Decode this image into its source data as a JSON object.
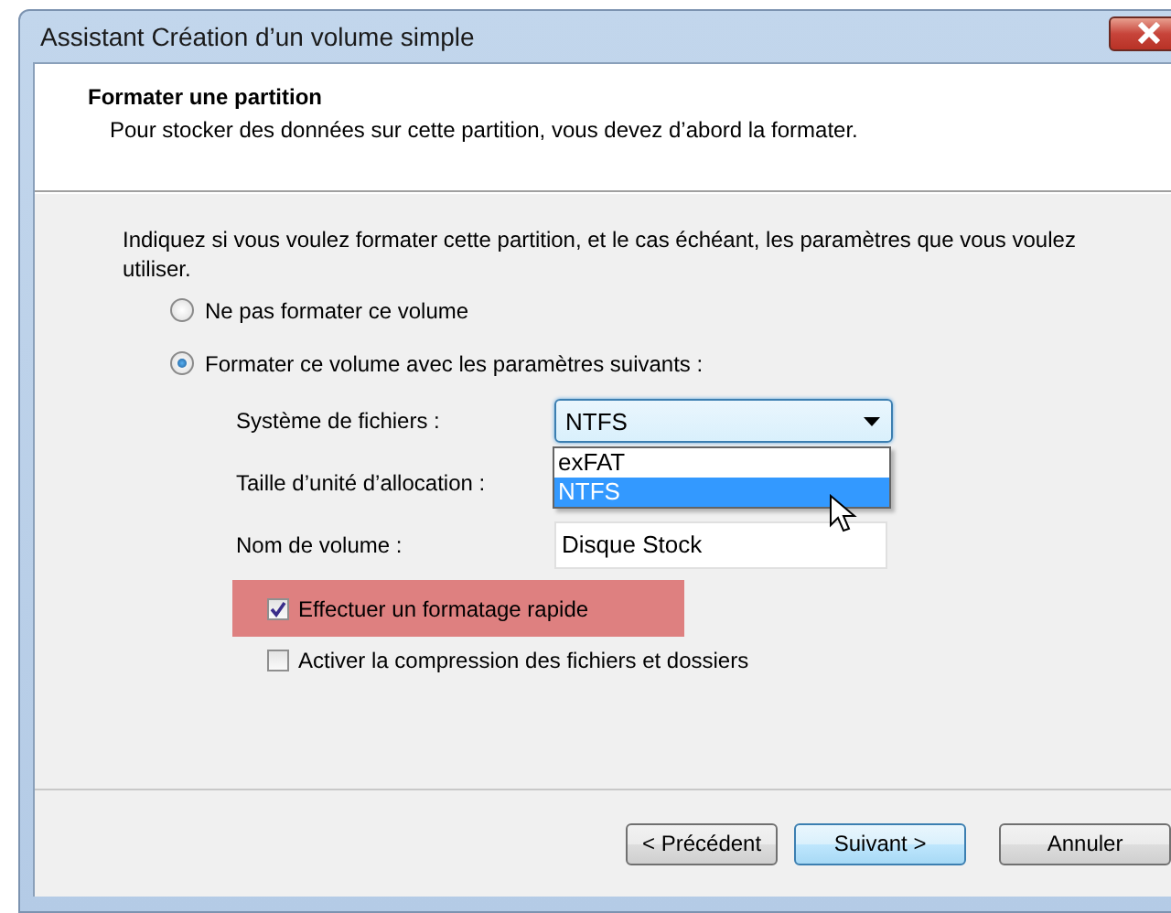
{
  "window": {
    "title": "Assistant Création d’un volume simple"
  },
  "header": {
    "title": "Formater une partition",
    "subtitle": "Pour stocker des données sur cette partition, vous devez d’abord la formater."
  },
  "intro": "Indiquez si vous voulez formater cette partition, et le cas échéant, les paramètres que vous voulez utiliser.",
  "options": [
    {
      "label": "Ne pas formater ce volume",
      "selected": false
    },
    {
      "label": "Formater ce volume avec les paramètres suivants :",
      "selected": true
    }
  ],
  "file_system": {
    "label": "Système de fichiers :",
    "value": "NTFS",
    "expanded": true,
    "options": [
      {
        "label": "exFAT",
        "selected": false
      },
      {
        "label": "NTFS",
        "selected": true
      }
    ]
  },
  "allocation_size": {
    "label": "Taille d’unité d’allocation :"
  },
  "volume_name": {
    "label": "Nom de volume :",
    "value": "Disque Stock"
  },
  "checkboxes": [
    {
      "label": "Effectuer un formatage rapide",
      "checked": true,
      "highlighted": true
    },
    {
      "label": "Activer la compression des fichiers et dossiers",
      "checked": false,
      "highlighted": false
    }
  ],
  "buttons": [
    {
      "label": "< Précédent",
      "default": false
    },
    {
      "label": "Suivant >",
      "default": true
    },
    {
      "label": "Annuler",
      "default": false
    }
  ]
}
